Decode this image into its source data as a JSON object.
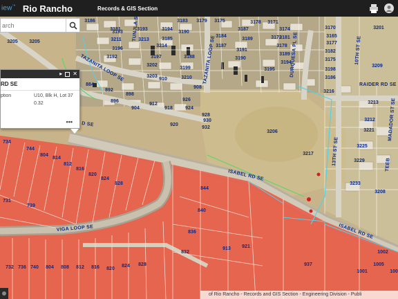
{
  "header": {
    "brand": "iew",
    "brand_mark": "™",
    "title": "Rio Rancho",
    "subtitle": "Records & GIS Section"
  },
  "search": {
    "placeholder": "arch"
  },
  "popup": {
    "title": "RD SE",
    "rows": [
      {
        "key": "ption",
        "value": "U10, Blk H, Lot 37"
      },
      {
        "key": "",
        "value": "0.32"
      }
    ],
    "more": "•••"
  },
  "attribution": "of Rio Rancho - Records and GIS Section - Engineering Division - Publi",
  "streets": {
    "tazanita": "TAZANITA LOOP SE",
    "tunjla": "TUNJLA ST SE",
    "tazanita_loop": "TAZANITA LOOP SE",
    "durquesa": "DURQUESA PL SE",
    "tenth": "10TH ST SE",
    "raider": "RAIDER RD SE",
    "madador": "MADADOR ST SE",
    "isabel": "ISABEL RD SE",
    "isabel2": "ISABEL RD SE",
    "viga": "VIGA LOOP SE",
    "thirteenth": "13TH ST SE",
    "teeb": "TEEB",
    "rd_se": "RD SE",
    "d_se": "D SE"
  },
  "lots": {
    "top": [
      "3186",
      "3183",
      "3179",
      "3175",
      "3171",
      "3181",
      "3193",
      "3194",
      "3190",
      "3187",
      "3178",
      "3174",
      "3170",
      "3165",
      "3172",
      "3205",
      "3193",
      "3185",
      "3184",
      "3189",
      "3181",
      "3177",
      "3201",
      "3211",
      "3213",
      "3214",
      "3178",
      "3197",
      "3188",
      "3187",
      "3182",
      "3209",
      "3196",
      "3192",
      "3191",
      "3190",
      "3189",
      "3175",
      "3198",
      "3202",
      "3199",
      "3195",
      "3194",
      "3186",
      "3210",
      "3203",
      "3205"
    ],
    "mid": [
      "884",
      "892",
      "898",
      "896",
      "904",
      "910",
      "912",
      "908",
      "918",
      "926",
      "924",
      "920",
      "928",
      "930",
      "932",
      "3206",
      "3213",
      "3217",
      "3225",
      "3221",
      "3229",
      "3216",
      "3233",
      "3212",
      "3208"
    ],
    "red": [
      "734",
      "744",
      "804",
      "814",
      "812",
      "816",
      "820",
      "824",
      "828",
      "731",
      "739",
      "844",
      "840",
      "836",
      "832",
      "913",
      "921",
      "937",
      "1001",
      "1002",
      "1005",
      "1006",
      "732",
      "736",
      "740",
      "804",
      "808",
      "812",
      "816",
      "820",
      "824",
      "828"
    ]
  },
  "colors": {
    "parcel_red": "#e85a45",
    "header_bg": "#1f1f1f",
    "brand_blue": "#4aa3df",
    "label_blue": "#0b2a8a"
  }
}
